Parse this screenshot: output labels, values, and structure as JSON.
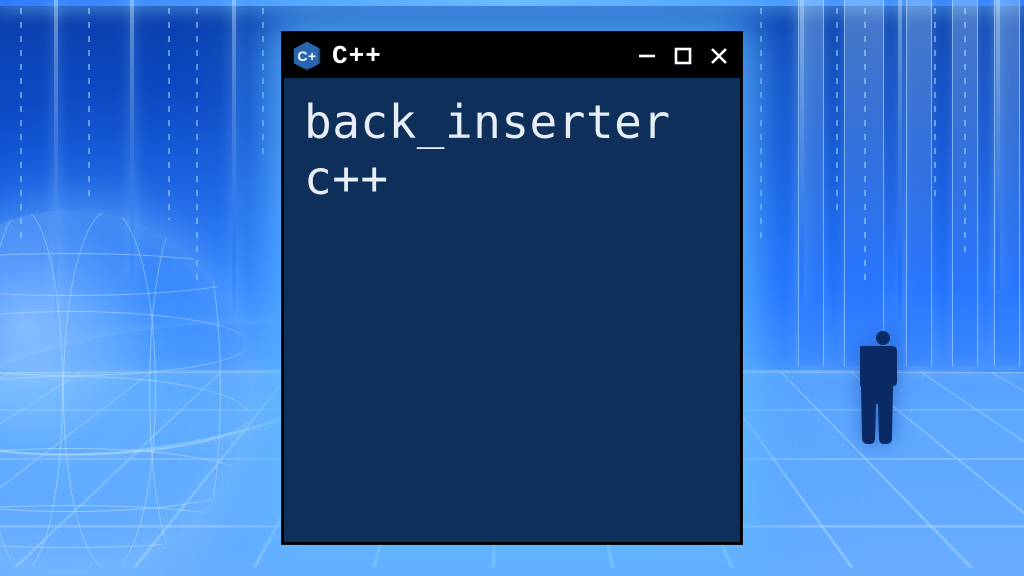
{
  "window": {
    "logo_text": "C+",
    "title": "C++",
    "content": {
      "line1": "back_inserter",
      "line2": "c++"
    },
    "controls": {
      "minimize": "minimize",
      "maximize": "maximize",
      "close": "close"
    }
  },
  "bg": {
    "globe": "wireframe-globe",
    "figure": "standing-person-silhouette"
  }
}
